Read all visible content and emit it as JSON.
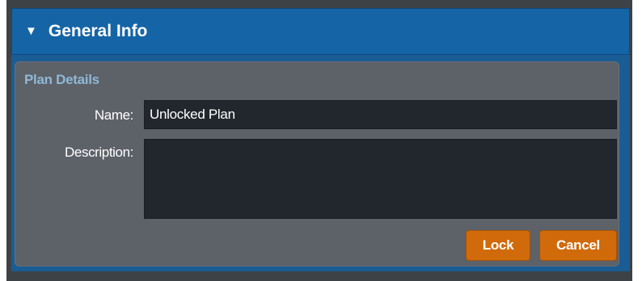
{
  "panel": {
    "title": "General Info",
    "toggle_glyph": "▼",
    "toggle_icon": "triangle-down-icon",
    "header_color": "#1565a6"
  },
  "plan_details": {
    "legend": "Plan Details",
    "name_label": "Name:",
    "name_value": "Unlocked Plan",
    "description_label": "Description:",
    "description_value": ""
  },
  "actions": {
    "lock_label": "Lock",
    "cancel_label": "Cancel",
    "button_color": "#d06a0a"
  }
}
